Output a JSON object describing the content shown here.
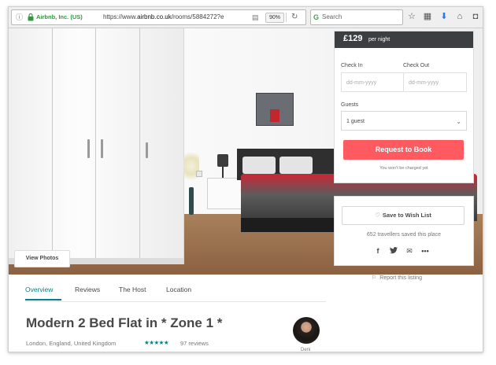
{
  "browser": {
    "site_identity": "Airbnb, Inc. (US)",
    "url_prefix": "https://www.",
    "url_domain": "airbnb.co.uk",
    "url_path": "/rooms/5884272?e",
    "zoom": "90%",
    "search_placeholder": "Search",
    "icons": [
      "info-icon",
      "lock-icon",
      "reader-view-icon",
      "reload-icon",
      "bookmark-star-icon",
      "reading-list-icon",
      "download-icon",
      "home-icon",
      "pocket-icon"
    ]
  },
  "hero": {
    "view_photos_label": "View Photos"
  },
  "booking": {
    "price": "£129",
    "per_night": "per night",
    "check_in_label": "Check In",
    "check_out_label": "Check Out",
    "check_in_placeholder": "dd-mm-yyyy",
    "check_out_placeholder": "dd-mm-yyyy",
    "guests_label": "Guests",
    "guests_value": "1 guest",
    "request_button": "Request to Book",
    "no_charge_note": "You won't be charged yet",
    "accent_color": "#ff5a5f"
  },
  "wishlist": {
    "button_label": "Save to Wish List",
    "saved_count_text": "652 travellers saved this place",
    "share_icons": [
      "facebook-icon",
      "twitter-icon",
      "email-icon",
      "more-icon"
    ]
  },
  "report_link": "Report this listing",
  "tabs": [
    {
      "label": "Overview",
      "active": true
    },
    {
      "label": "Reviews",
      "active": false
    },
    {
      "label": "The Host",
      "active": false
    },
    {
      "label": "Location",
      "active": false
    }
  ],
  "listing": {
    "title": "Modern 2 Bed Flat in * Zone 1 *",
    "location": "London, England, United Kingdom",
    "rating_stars": 4.5,
    "stars_text": "★★★★★",
    "reviews_text": "97 reviews",
    "host_name": "Deni",
    "brand_color": "#008489"
  }
}
